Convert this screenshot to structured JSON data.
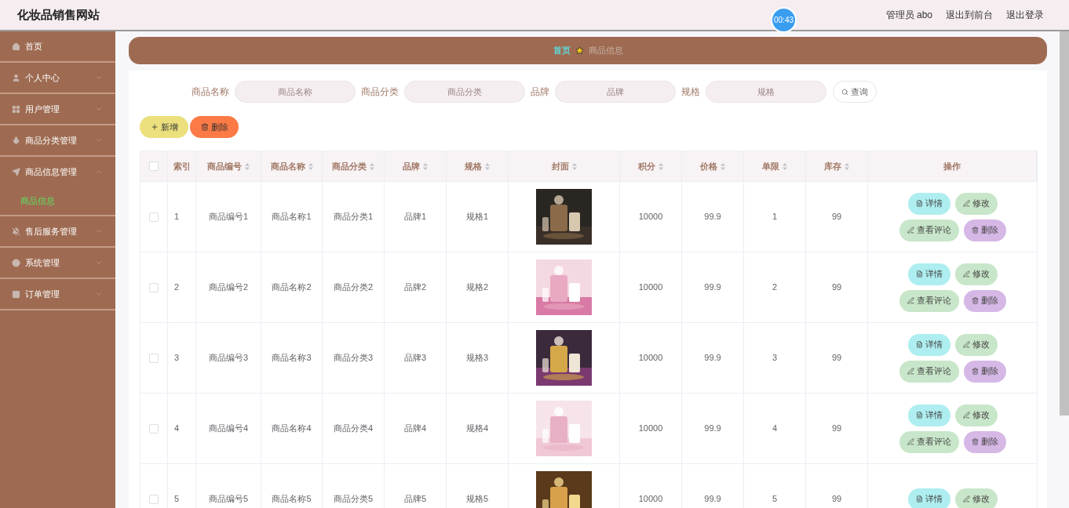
{
  "header": {
    "title": "化妆品销售网站",
    "links": [
      "管理员 abo",
      "退出到前台",
      "退出登录"
    ]
  },
  "timer": {
    "text": "00:43"
  },
  "sidebar": {
    "items": [
      {
        "label": "首页"
      },
      {
        "label": "个人中心",
        "expanded": false
      },
      {
        "label": "用户管理",
        "expanded": false
      },
      {
        "label": "商品分类管理",
        "expanded": false
      },
      {
        "label": "商品信息管理",
        "expanded": true,
        "children": [
          {
            "label": "商品信息",
            "selected": true
          }
        ]
      },
      {
        "label": "售后服务管理",
        "expanded": false
      },
      {
        "label": "系统管理",
        "expanded": false
      },
      {
        "label": "订单管理",
        "expanded": false
      }
    ]
  },
  "breadcrumb": [
    "首页",
    "商品信息"
  ],
  "search": {
    "fields": [
      {
        "label": "商品名称",
        "placeholder": "商品名称"
      },
      {
        "label": "商品分类",
        "placeholder": "商品分类"
      },
      {
        "label": "品牌",
        "placeholder": "品牌"
      },
      {
        "label": "规格",
        "placeholder": "规格"
      }
    ],
    "button": "查询"
  },
  "toolbar": [
    {
      "kind": "add",
      "label": "新增"
    },
    {
      "kind": "delete",
      "label": "删除"
    }
  ],
  "table": {
    "columns": [
      "索引",
      "商品编号",
      "商品名称",
      "商品分类",
      "品牌",
      "规格",
      "封面",
      "积分",
      "价格",
      "单限",
      "库存",
      "操作"
    ],
    "header_checked": false,
    "rows": [
      {
        "selected": false,
        "cells": [
          "1",
          "商品编号1",
          "商品名称1",
          "商品分类1",
          "品牌1",
          "规格1",
          {
            "kind": "picture"
          },
          "10000",
          "99.9",
          "1",
          "99"
        ],
        "actions": [
          {
            "kind": "detail",
            "label": "详情"
          },
          {
            "kind": "edit",
            "label": "修改"
          },
          {
            "kind": "comments",
            "label": "查看评论"
          },
          {
            "kind": "delete",
            "label": "删除"
          }
        ]
      },
      {
        "selected": false,
        "cells": [
          "2",
          "商品编号2",
          "商品名称2",
          "商品分类2",
          "品牌2",
          "规格2",
          {
            "kind": "picture"
          },
          "10000",
          "99.9",
          "2",
          "99"
        ],
        "actions": [
          {
            "kind": "detail",
            "label": "详情"
          },
          {
            "kind": "edit",
            "label": "修改"
          },
          {
            "kind": "comments",
            "label": "查看评论"
          },
          {
            "kind": "delete",
            "label": "删除"
          }
        ]
      },
      {
        "selected": false,
        "cells": [
          "3",
          "商品编号3",
          "商品名称3",
          "商品分类3",
          "品牌3",
          "规格3",
          {
            "kind": "picture"
          },
          "10000",
          "99.9",
          "3",
          "99"
        ],
        "actions": [
          {
            "kind": "detail",
            "label": "详情"
          },
          {
            "kind": "edit",
            "label": "修改"
          },
          {
            "kind": "comments",
            "label": "查看评论"
          },
          {
            "kind": "delete",
            "label": "删除"
          }
        ]
      },
      {
        "selected": false,
        "cells": [
          "4",
          "商品编号4",
          "商品名称4",
          "商品分类4",
          "品牌4",
          "规格4",
          {
            "kind": "picture"
          },
          "10000",
          "99.9",
          "4",
          "99"
        ],
        "actions": [
          {
            "kind": "detail",
            "label": "详情"
          },
          {
            "kind": "edit",
            "label": "修改"
          },
          {
            "kind": "comments",
            "label": "查看评论"
          },
          {
            "kind": "delete",
            "label": "删除"
          }
        ]
      },
      {
        "selected": false,
        "cells": [
          "5",
          "商品编号5",
          "商品名称5",
          "商品分类5",
          "品牌5",
          "规格5",
          {
            "kind": "picture"
          },
          "10000",
          "99.9",
          "5",
          "99"
        ],
        "actions": [
          {
            "kind": "detail",
            "label": "详情"
          },
          {
            "kind": "edit",
            "label": "修改"
          }
        ]
      }
    ]
  }
}
